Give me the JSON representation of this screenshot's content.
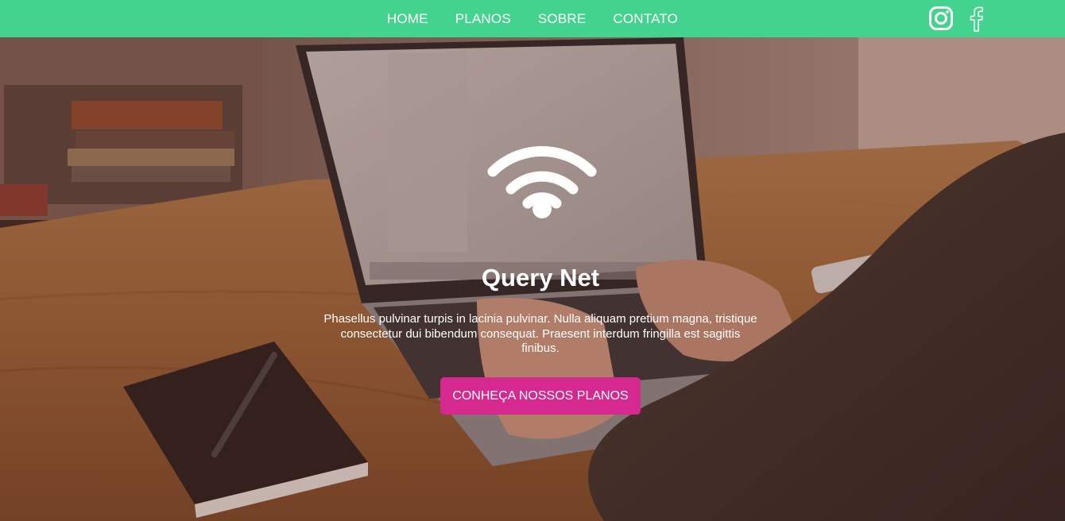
{
  "nav": {
    "links": [
      "HOME",
      "PLANOS",
      "SOBRE",
      "CONTATO"
    ],
    "social": [
      "instagram-icon",
      "facebook-icon"
    ]
  },
  "hero": {
    "icon": "wifi-icon",
    "title": "Query Net",
    "text": "Phasellus pulvinar turpis in lacinia pulvinar. Nulla aliquam pretium magna, tristique consectetur dui bibendum consequat. Praesent interdum fringilla est sagittis finibus.",
    "cta": "CONHEÇA NOSSOS PLANOS"
  },
  "colors": {
    "navbar": "#44d28f",
    "cta": "#d6298f",
    "text": "#ffffff"
  }
}
